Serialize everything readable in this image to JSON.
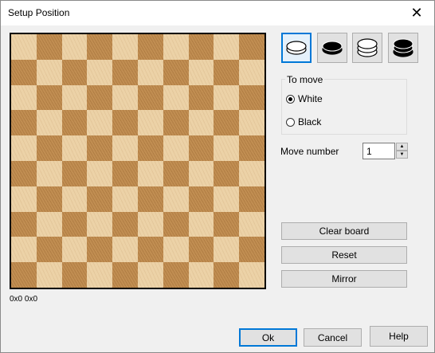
{
  "window": {
    "title": "Setup Position",
    "close_glyph": "✕"
  },
  "board": {
    "size": 10,
    "coords": "0x0  0x0"
  },
  "piece_tools": [
    {
      "name": "white-man-icon",
      "kind": "white-man",
      "selected": true
    },
    {
      "name": "black-man-icon",
      "kind": "black-man",
      "selected": false
    },
    {
      "name": "white-king-icon",
      "kind": "white-king",
      "selected": false
    },
    {
      "name": "black-king-icon",
      "kind": "black-king",
      "selected": false
    }
  ],
  "to_move": {
    "label": "To move",
    "options": [
      {
        "label": "White",
        "checked": true
      },
      {
        "label": "Black",
        "checked": false
      }
    ]
  },
  "move_number": {
    "label": "Move number",
    "value": "1"
  },
  "actions": {
    "clear_board": "Clear board",
    "reset": "Reset",
    "mirror": "Mirror"
  },
  "footer": {
    "ok": "Ok",
    "cancel": "Cancel",
    "help": "Help"
  },
  "colors": {
    "light_square": "#ecd2a7",
    "dark_square": "#c18e52",
    "accent": "#0078d7"
  }
}
